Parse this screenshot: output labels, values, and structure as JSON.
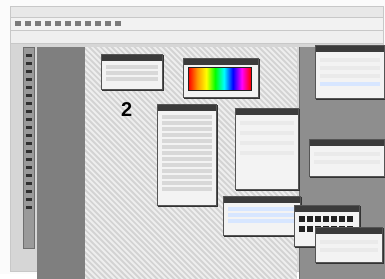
{
  "step_number": "2",
  "icons": {
    "app_menu": "menu-items",
    "tools": "toolbox-icons",
    "swatches": "swatch-grid"
  }
}
